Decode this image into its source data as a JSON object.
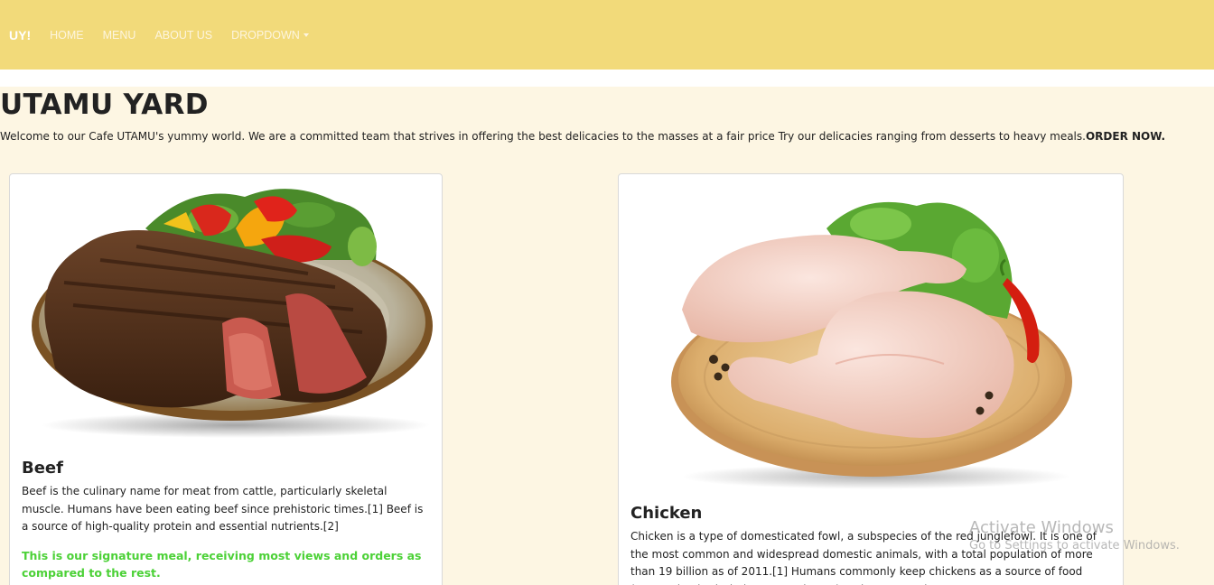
{
  "nav": {
    "brand": "UY!",
    "links": [
      "HOME",
      "MENU",
      "ABOUT US"
    ],
    "dropdown_label": "DROPDOWN"
  },
  "header": {
    "title": "UTAMU YARD",
    "intro": "Welcome to our Cafe UTAMU's yummy world. We are a committed team that strives in offering the best delicacies to the masses at a fair price Try our delicacies ranging from desserts to heavy meals.",
    "intro_cta": "ORDER NOW."
  },
  "cards": [
    {
      "title": "Beef",
      "text": "Beef is the culinary name for meat from cattle, particularly skeletal muscle. Humans have been eating beef since prehistoric times.[1] Beef is a source of high-quality protein and essential nutrients.[2]",
      "highlight": "This is our signature meal, receiving most views and orders as compared to the rest."
    },
    {
      "title": "Chicken",
      "text": "Chicken is a type of domesticated fowl, a subspecies of the red junglefowl. It is one of the most common and widespread domestic animals, with a total population of more than 19 billion as of 2011.[1] Humans commonly keep chickens as a source of food (consuming both their meat and eggs) and, more rarely, as pets."
    }
  ],
  "watermark": {
    "title": "Activate Windows",
    "subtitle": "Go to Settings to activate Windows."
  },
  "colors": {
    "navbar": "#f2da7a",
    "page_bg": "#fdf6e3",
    "highlight": "#4cd137"
  }
}
